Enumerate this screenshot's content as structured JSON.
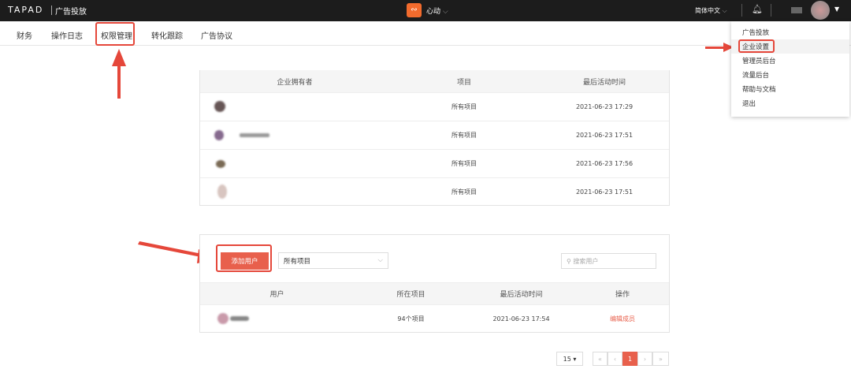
{
  "topbar": {
    "brand": "TAPAD",
    "product": "广告投放",
    "app_name": "心动",
    "language": "简体中文"
  },
  "nav": {
    "items": [
      "财务",
      "操作日志",
      "权限管理",
      "转化跟踪",
      "广告协议"
    ],
    "highlighted": "权限管理"
  },
  "user_menu": {
    "items": [
      "广告投放",
      "企业设置",
      "管理员后台",
      "流量后台",
      "帮助与文档",
      "退出"
    ],
    "highlighted": "企业设置"
  },
  "owners_table": {
    "headers": [
      "企业拥有者",
      "项目",
      "最后活动时间"
    ],
    "rows": [
      {
        "project": "所有项目",
        "time": "2021-06-23 17:29"
      },
      {
        "project": "所有项目",
        "time": "2021-06-23 17:51"
      },
      {
        "project": "所有项目",
        "time": "2021-06-23 17:56"
      },
      {
        "project": "所有项目",
        "time": "2021-06-23 17:51"
      }
    ]
  },
  "users_panel": {
    "add_button": "添加用户",
    "project_select": "所有项目",
    "search_placeholder": "搜索用户",
    "headers": [
      "用户",
      "所在项目",
      "最后活动时间",
      "操作"
    ],
    "rows": [
      {
        "project": "94个项目",
        "time": "2021-06-23 17:54",
        "action": "编辑成员"
      }
    ]
  },
  "pagination": {
    "page_size": "15",
    "current_page": "1"
  },
  "colors": {
    "accent": "#e8604c",
    "highlight": "#e5473a"
  }
}
